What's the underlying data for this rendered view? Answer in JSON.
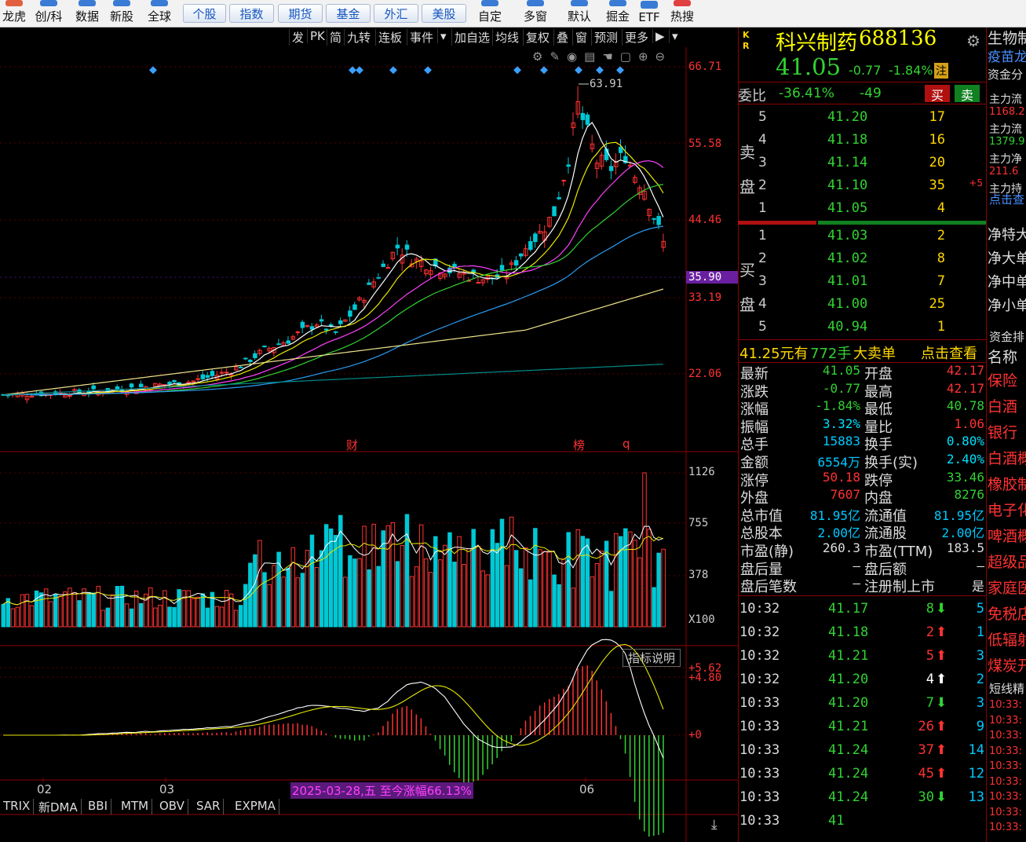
{
  "topbar": {
    "left_items": [
      "龙虎",
      "创/科",
      "数据",
      "新股",
      "全球"
    ],
    "buttons": [
      "个股",
      "指数",
      "期货",
      "基金",
      "外汇",
      "美股"
    ],
    "right_items": [
      "自定",
      "多窗",
      "默认",
      "掘金",
      "ETF",
      "热搜"
    ]
  },
  "chart_tools": [
    "发",
    "PK",
    "简",
    "九转",
    "连板",
    "事件",
    "▾",
    "加自选",
    "均线",
    "复权",
    "叠",
    "窗",
    "预测",
    "更多",
    "▶",
    "▾"
  ],
  "price_axis": [
    "66.71",
    "55.58",
    "44.46",
    "35.90",
    "33.19",
    "22.06"
  ],
  "high_marker": "63.91",
  "event_markers": [
    "财",
    "榜",
    "q"
  ],
  "volume_axis": [
    "1126",
    "755",
    "378",
    "X100"
  ],
  "macd_axis": [
    "+5.62",
    "+4.80",
    "+0"
  ],
  "macd_button": "指标说明",
  "date_axis": [
    "02",
    "03",
    "06"
  ],
  "range_note": "2025-03-28,五 至今涨幅66.13%",
  "indicator_tabs": [
    "TRIX",
    "新DMA",
    "BBI",
    "MTM",
    "OBV",
    "SAR",
    "EXPMA"
  ],
  "header": {
    "kr": "K R",
    "name": "科兴制药",
    "code": "688136",
    "price": "41.05",
    "change": "-0.77",
    "pct": "-1.84%",
    "badge": "注"
  },
  "weibi": {
    "label": "委比",
    "ratio": "-36.41%",
    "diff": "-49",
    "buy": "买",
    "sell": "卖"
  },
  "sell_label": [
    "卖",
    "盘"
  ],
  "buy_label": [
    "买",
    "盘"
  ],
  "asks": [
    {
      "lv": "5",
      "p": "41.20",
      "v": "17",
      "x": ""
    },
    {
      "lv": "4",
      "p": "41.18",
      "v": "16",
      "x": ""
    },
    {
      "lv": "3",
      "p": "41.14",
      "v": "20",
      "x": ""
    },
    {
      "lv": "2",
      "p": "41.10",
      "v": "35",
      "x": "+5"
    },
    {
      "lv": "1",
      "p": "41.05",
      "v": "4",
      "x": ""
    }
  ],
  "bids": [
    {
      "lv": "1",
      "p": "41.03",
      "v": "2"
    },
    {
      "lv": "2",
      "p": "41.02",
      "v": "8"
    },
    {
      "lv": "3",
      "p": "41.01",
      "v": "7"
    },
    {
      "lv": "4",
      "p": "41.00",
      "v": "25"
    },
    {
      "lv": "5",
      "p": "40.94",
      "v": "1"
    }
  ],
  "bigorder": {
    "price": "41.25元有",
    "qty": "772手",
    "label": "大卖单",
    "link": "点击查看"
  },
  "stats": [
    [
      "最新",
      "41.05",
      "开盘",
      "42.17"
    ],
    [
      "涨跌",
      "-0.77",
      "最高",
      "42.17"
    ],
    [
      "涨幅",
      "-1.84%",
      "最低",
      "40.78"
    ],
    [
      "振幅",
      "3.32%",
      "量比",
      "1.06"
    ],
    [
      "总手",
      "15883",
      "换手",
      "0.80%"
    ],
    [
      "金额",
      "6554万",
      "换手(实)",
      "2.40%"
    ],
    [
      "涨停",
      "50.18",
      "跌停",
      "33.46"
    ],
    [
      "外盘",
      "7607",
      "内盘",
      "8276"
    ],
    [
      "总市值",
      "81.95亿",
      "流通值",
      "81.95亿"
    ],
    [
      "总股本",
      "2.00亿",
      "流通股",
      "2.00亿"
    ],
    [
      "市盈(静)",
      "260.3",
      "市盈(TTM)",
      "183.5"
    ],
    [
      "盘后量",
      "–",
      "盘后额",
      "–"
    ],
    [
      "盘后笔数",
      "–",
      "注册制上市",
      "是"
    ]
  ],
  "trades": [
    {
      "t": "10:32",
      "p": "41.17",
      "v": "8",
      "d": "down",
      "n": "5"
    },
    {
      "t": "10:32",
      "p": "41.18",
      "v": "2",
      "d": "up",
      "n": "1"
    },
    {
      "t": "10:32",
      "p": "41.21",
      "v": "5",
      "d": "up",
      "n": "3"
    },
    {
      "t": "10:32",
      "p": "41.20",
      "v": "4",
      "d": "upw",
      "n": "2"
    },
    {
      "t": "10:33",
      "p": "41.20",
      "v": "7",
      "d": "down",
      "n": "3"
    },
    {
      "t": "10:33",
      "p": "41.21",
      "v": "26",
      "d": "up",
      "n": "9"
    },
    {
      "t": "10:33",
      "p": "41.24",
      "v": "37",
      "d": "up",
      "n": "14"
    },
    {
      "t": "10:33",
      "p": "41.24",
      "v": "45",
      "d": "up",
      "n": "12"
    },
    {
      "t": "10:33",
      "p": "41.24",
      "v": "30",
      "d": "down",
      "n": "13"
    },
    {
      "t": "10:33",
      "p": "41",
      "v": "",
      "d": "",
      "n": ""
    }
  ],
  "side": {
    "top": [
      "生物制",
      "疫苗龙"
    ],
    "fund": "资金分",
    "flows": [
      [
        "主力流",
        "1168.2"
      ],
      [
        "主力流",
        "1379.9"
      ],
      [
        "主力净",
        "211.6"
      ],
      [
        "主力持",
        ""
      ]
    ],
    "click": "点击查",
    "nets": [
      "净特大",
      "净大单",
      "净中单",
      "净小单"
    ],
    "rank": "资金排",
    "name": "名称",
    "sectors": [
      "保险",
      "白酒",
      "银行",
      "白酒概",
      "橡胶制",
      "电子化",
      "啤酒概",
      "超级品",
      "家庭医",
      "免税店",
      "低辐射",
      "煤炭开"
    ],
    "short": "短线精",
    "times": [
      "10:33:",
      "10:33:",
      "10:33:",
      "10:33:",
      "10:33:",
      "10:33:",
      "10:33:",
      "10:33:",
      "10:33:"
    ]
  },
  "colors": {
    "up": "#ff3232",
    "down": "#32d232",
    "cyan": "#00c8d4",
    "yellow": "#e8e800",
    "panel_red": "#8b0000"
  }
}
